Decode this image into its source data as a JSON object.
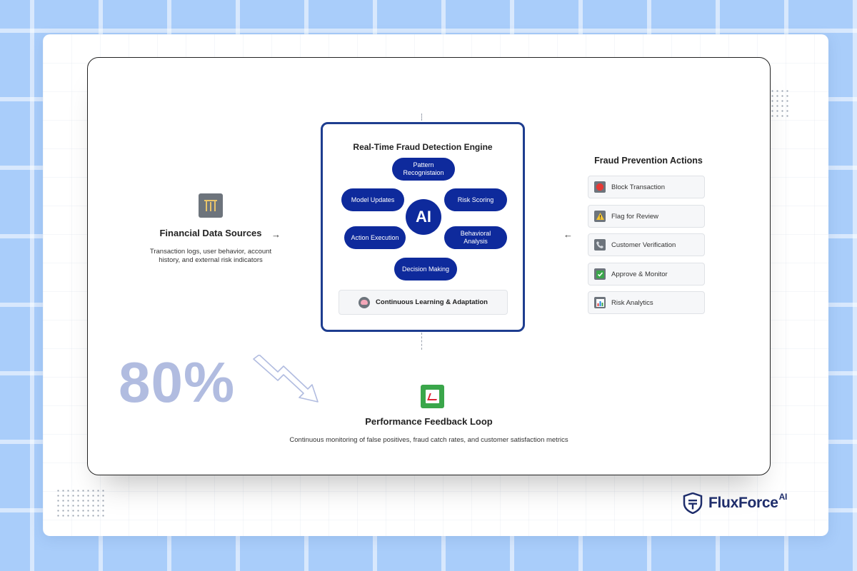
{
  "engine": {
    "title": "Real-Time Fraud Detection Engine",
    "center_label": "AI",
    "nodes": [
      "Pattern Recognistaion",
      "Model Updates",
      "Risk Scoring",
      "Action Execution",
      "Behavioral Analysis",
      "Decision Making"
    ],
    "footer": "Continuous Learning & Adaptation"
  },
  "inputs": {
    "title": "Financial Data Sources",
    "description": "Transaction logs, user behavior, account history, and external risk indicators",
    "arrow": "→"
  },
  "actions": {
    "title": "Fraud Prevention Actions",
    "arrow": "←",
    "items": [
      {
        "label": "Block Transaction",
        "icon": "stop-sign-icon"
      },
      {
        "label": "Flag for Review",
        "icon": "warning-icon"
      },
      {
        "label": "Customer Verification",
        "icon": "phone-icon"
      },
      {
        "label": "Approve & Monitor",
        "icon": "check-icon"
      },
      {
        "label": "Risk Analytics",
        "icon": "bar-chart-icon"
      }
    ]
  },
  "feedback": {
    "title": "Performance Feedback Loop",
    "description": "Continuous monitoring of false positives, fraud catch rates, and customer satisfaction metrics"
  },
  "stat": {
    "value": "80%"
  },
  "brand": {
    "name": "FluxForce",
    "suffix": "AI"
  }
}
